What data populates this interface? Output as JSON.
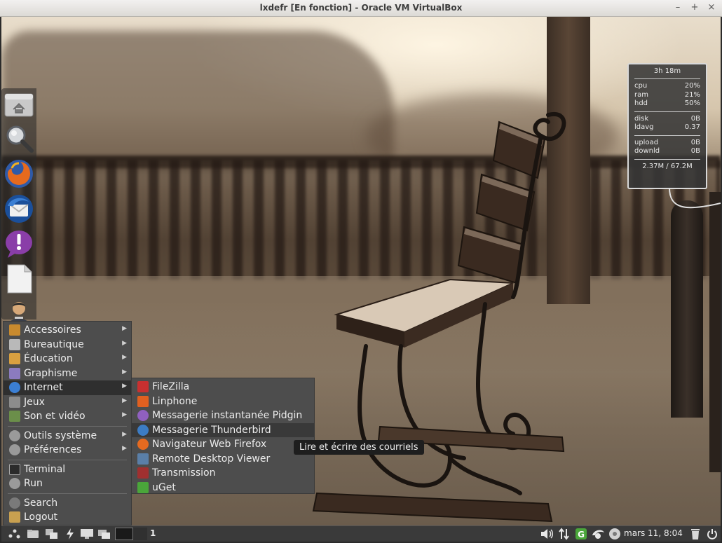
{
  "window": {
    "title": "lxdefr [En fonction] - Oracle VM VirtualBox",
    "controls": {
      "minimize": "–",
      "maximize": "+",
      "close": "×"
    }
  },
  "dock": {
    "items": [
      {
        "name": "home-folder",
        "icon": "home-folder-icon"
      },
      {
        "name": "search",
        "icon": "magnifier-icon"
      },
      {
        "name": "firefox",
        "icon": "firefox-icon"
      },
      {
        "name": "thunderbird",
        "icon": "thunderbird-icon"
      },
      {
        "name": "pidgin",
        "icon": "pidgin-icon"
      },
      {
        "name": "document",
        "icon": "document-icon"
      },
      {
        "name": "user",
        "icon": "user-icon"
      }
    ]
  },
  "conky": {
    "uptime": "3h 18m",
    "rows1": [
      {
        "label": "cpu",
        "value": "20%"
      },
      {
        "label": "ram",
        "value": "21%"
      },
      {
        "label": "hdd",
        "value": "50%"
      }
    ],
    "rows2": [
      {
        "label": "disk",
        "value": "0B"
      },
      {
        "label": "ldavg",
        "value": "0.37"
      }
    ],
    "rows3": [
      {
        "label": "upload",
        "value": "0B"
      },
      {
        "label": "downld",
        "value": "0B"
      }
    ],
    "total": "2.37M / 67.2M"
  },
  "menu": {
    "items": [
      {
        "label": "Accessoires",
        "submenu": true,
        "color": "#c88a2e"
      },
      {
        "label": "Bureautique",
        "submenu": true,
        "color": "#b9b9b9"
      },
      {
        "label": "Éducation",
        "submenu": true,
        "color": "#d8a040"
      },
      {
        "label": "Graphisme",
        "submenu": true,
        "color": "#8b7bbf"
      },
      {
        "label": "Internet",
        "submenu": true,
        "color": "#3b7fd4",
        "active": true
      },
      {
        "label": "Jeux",
        "submenu": true,
        "color": "#8c8c8c"
      },
      {
        "label": "Son et vidéo",
        "submenu": true,
        "color": "#6b8f4a"
      },
      {
        "label": "Outils système",
        "submenu": true,
        "color": "#9a9a9a"
      },
      {
        "label": "Préférences",
        "submenu": true,
        "color": "#9a9a9a"
      },
      {
        "label": "Terminal",
        "submenu": false,
        "color": "#2b2b2b"
      },
      {
        "label": "Run",
        "submenu": false,
        "color": "#9a9a9a"
      },
      {
        "label": "Search",
        "submenu": false,
        "color": "#7a7a7a"
      },
      {
        "label": "Logout",
        "submenu": false,
        "color": "#c8a050"
      }
    ]
  },
  "submenu": {
    "items": [
      {
        "label": "FileZilla",
        "color": "#c83030"
      },
      {
        "label": "Linphone",
        "color": "#e06020"
      },
      {
        "label": "Messagerie instantanée Pidgin",
        "color": "#9060c0"
      },
      {
        "label": "Messagerie Thunderbird",
        "color": "#3c7cc4",
        "hover": true
      },
      {
        "label": "Navigateur Web Firefox",
        "color": "#e56a20"
      },
      {
        "label": "Remote Desktop Viewer",
        "color": "#5a7fa8"
      },
      {
        "label": "Transmission",
        "color": "#a03030"
      },
      {
        "label": "uGet",
        "color": "#4aa63a"
      }
    ]
  },
  "tooltip": "Lire et écrire des courriels",
  "panel": {
    "workspace": "1",
    "clock": "mars 11,  8:04"
  }
}
